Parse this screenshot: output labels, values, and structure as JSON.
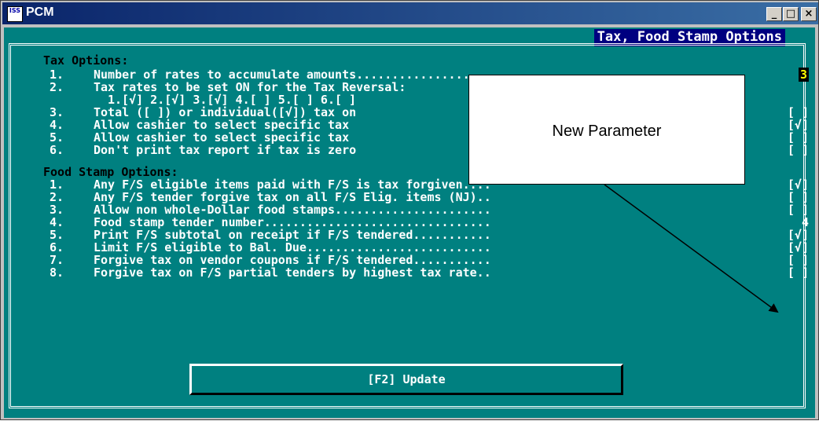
{
  "window": {
    "title": "PCM",
    "app_icon_text": "ISS",
    "buttons": {
      "minimize": "_",
      "maximize": "□",
      "close": "×"
    }
  },
  "screen": {
    "header_title": "Tax, Food Stamp Options",
    "tax_section_title": "Tax Options:",
    "tax_items": [
      {
        "num": "1.",
        "label": "Number of rates to accumulate amounts...................",
        "value": "3"
      },
      {
        "num": "2.",
        "label": "Tax rates to be set ON for the Tax Reversal:",
        "value": ""
      },
      {
        "num": "",
        "label": "1.[√] 2.[√] 3.[√] 4.[ ] 5.[ ] 6.[ ]",
        "value": ""
      },
      {
        "num": "3.",
        "label": "Total ([ ]) or individual([√]) tax on",
        "value": "[ ]"
      },
      {
        "num": "4.",
        "label": "Allow cashier to select specific tax",
        "value": "[√]"
      },
      {
        "num": "5.",
        "label": "Allow cashier to select specific tax",
        "value": "[ ]"
      },
      {
        "num": "6.",
        "label": "Don't print tax report if tax is zero",
        "value": "[ ]"
      }
    ],
    "food_section_title": "Food Stamp Options:",
    "food_items": [
      {
        "num": "1.",
        "label": "Any F/S eligible items paid with F/S is tax forgiven....",
        "value": "[√]"
      },
      {
        "num": "2.",
        "label": "Any F/S tender forgive tax on all F/S Elig. items (NJ)..",
        "value": "[ ]"
      },
      {
        "num": "3.",
        "label": "Allow non whole-Dollar food stamps......................",
        "value": "[ ]"
      },
      {
        "num": "4.",
        "label": "Food stamp tender number................................",
        "value": "4"
      },
      {
        "num": "5.",
        "label": "Print F/S subtotal on receipt if F/S tendered...........",
        "value": "[√]"
      },
      {
        "num": "6.",
        "label": "Limit F/S eligible to Bal. Due..........................",
        "value": "[√]"
      },
      {
        "num": "7.",
        "label": "Forgive tax on vendor coupons if F/S tendered...........",
        "value": "[ ]"
      },
      {
        "num": "8.",
        "label": "Forgive tax on F/S partial tenders by highest tax rate..",
        "value": "[ ]"
      }
    ],
    "update_button": "[F2] Update"
  },
  "callout": {
    "text": "New Parameter"
  },
  "colors": {
    "screen_bg": "#008080",
    "title_bg": "#000080",
    "value_highlight": "#ffff00"
  }
}
